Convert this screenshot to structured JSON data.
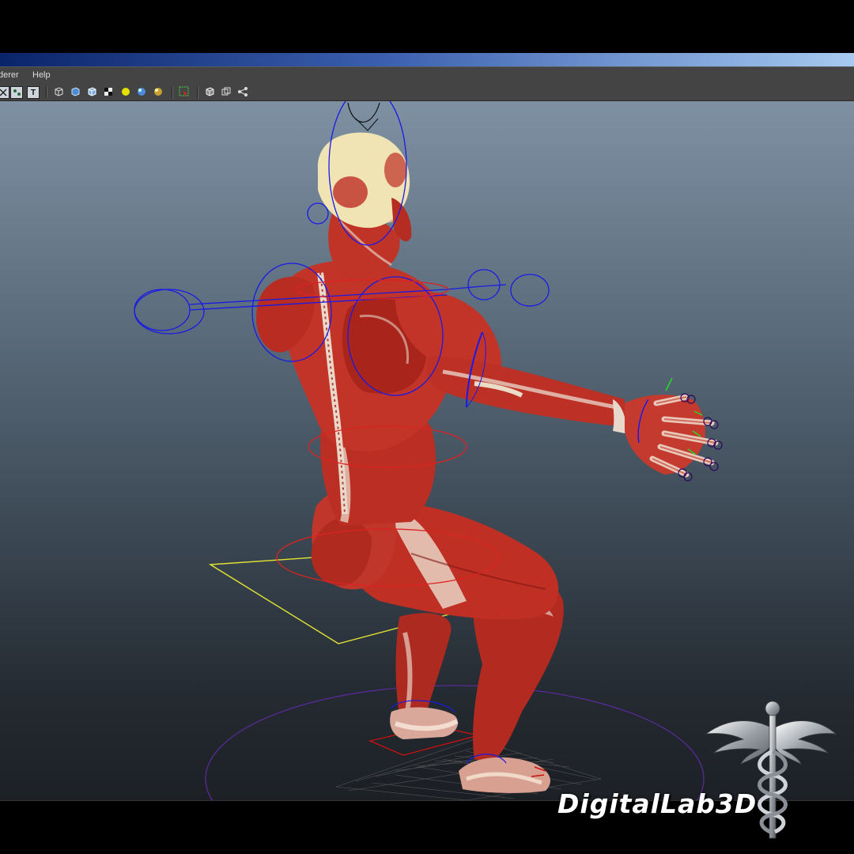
{
  "menubar": {
    "items": [
      {
        "label": "derer"
      },
      {
        "label": "Help"
      }
    ]
  },
  "toolbar": {
    "tools": [
      {
        "icon": "snap-grid-icon"
      },
      {
        "icon": "display-options-icon"
      },
      {
        "icon": "text-tool-icon",
        "glyph": "T"
      },
      {
        "icon": "wireframe-cube-icon"
      },
      {
        "icon": "smooth-shade-cube-icon"
      },
      {
        "icon": "wireframe-on-shaded-icon"
      },
      {
        "icon": "checker-texture-icon"
      },
      {
        "icon": "default-light-icon"
      },
      {
        "icon": "all-lights-icon"
      },
      {
        "icon": "shadows-icon"
      },
      {
        "icon": "select-tool-icon"
      },
      {
        "icon": "isolate-select-icon"
      },
      {
        "icon": "xray-icon"
      },
      {
        "icon": "joints-display-icon"
      }
    ]
  },
  "colors": {
    "skin": "#f0e3b4",
    "muscle": "#bb2b22",
    "muscle_dark": "#7e1712",
    "tendon": "#e4cfc3",
    "ik_control": "#1a1ae6",
    "torso_control": "#dd2222",
    "hip_control": "#e3e334",
    "root_circle": "#5a2a9a"
  },
  "watermark": {
    "text": "DigitalLab3D",
    "logo_icon": "caduceus-icon"
  }
}
